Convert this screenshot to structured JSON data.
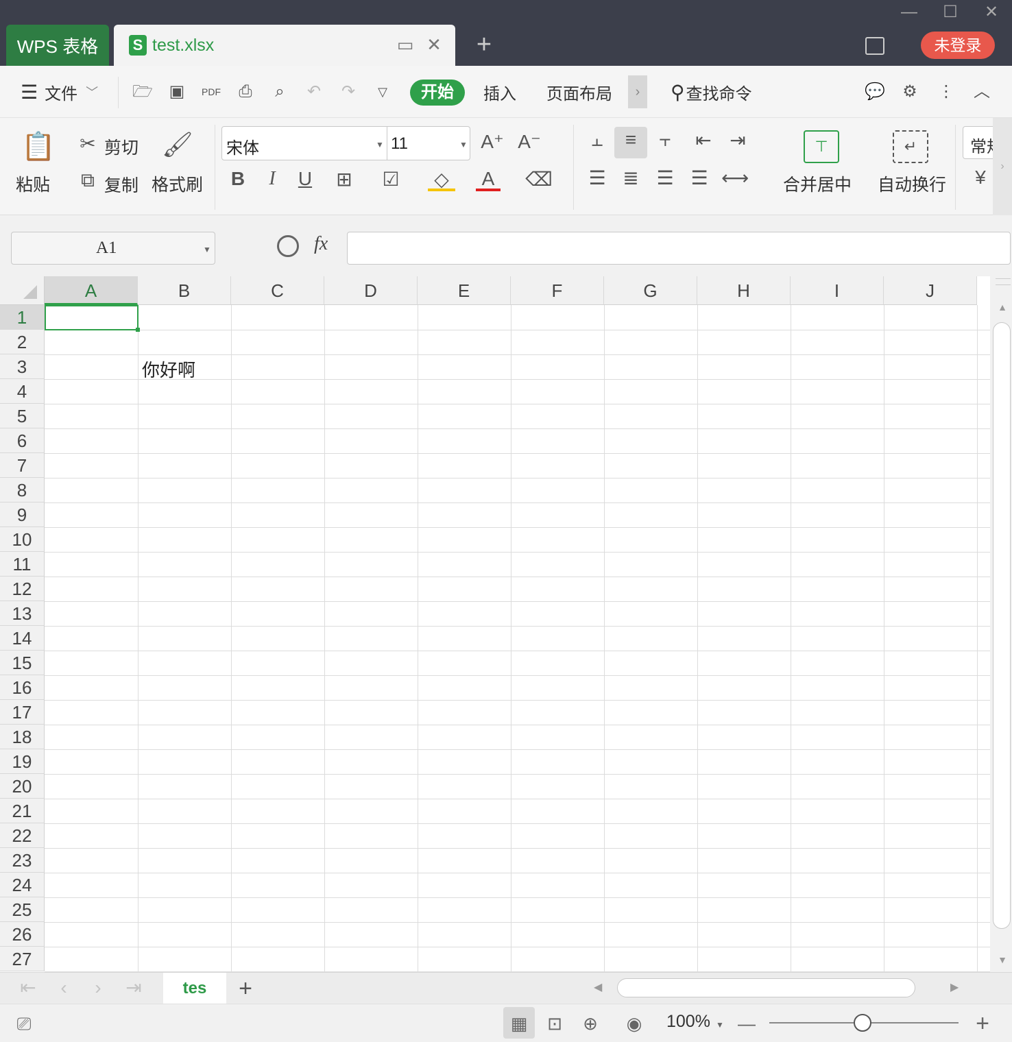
{
  "titlebar": {
    "app_tab": "WPS 表格",
    "file_tab": "test.xlsx",
    "file_icon": "S",
    "new_tab": "+",
    "login": "未登录",
    "minimize": "—",
    "maximize": "☐",
    "close": "✕"
  },
  "menubar": {
    "file_menu": "文件",
    "tabs": [
      "开始",
      "插入",
      "页面布局"
    ],
    "search_command": "查找命令"
  },
  "ribbon": {
    "paste": "粘贴",
    "cut": "剪切",
    "copy": "复制",
    "format_painter": "格式刷",
    "font_name": "宋体",
    "font_size": "11",
    "merge_center": "合并居中",
    "wrap_text": "自动换行",
    "number_format": "常规"
  },
  "formula_bar": {
    "name_box": "A1",
    "fx": "fx",
    "formula": ""
  },
  "sheet": {
    "columns": [
      "A",
      "B",
      "C",
      "D",
      "E",
      "F",
      "G",
      "H",
      "I",
      "J"
    ],
    "rows": [
      "1",
      "2",
      "3",
      "4",
      "5",
      "6",
      "7",
      "8",
      "9",
      "10",
      "11",
      "12",
      "13",
      "14",
      "15",
      "16",
      "17",
      "18",
      "19",
      "20",
      "21",
      "22",
      "23",
      "24",
      "25",
      "26",
      "27"
    ],
    "selected_cell": "A1",
    "cells": {
      "B3": "你好啊"
    }
  },
  "sheet_tabs": {
    "active": "tes",
    "add": "+"
  },
  "statusbar": {
    "zoom": "100%",
    "zoom_level": 1.0,
    "zoom_out": "—",
    "zoom_in": "+"
  }
}
